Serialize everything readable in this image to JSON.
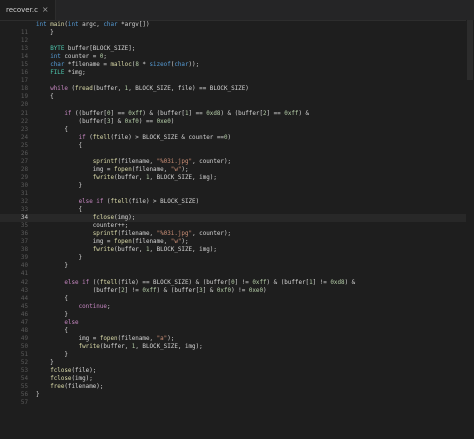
{
  "tab": {
    "filename": "recover.c",
    "close": "×"
  },
  "lines": [
    {
      "n": "",
      "text": "int main(int argc, char *argv[])"
    },
    {
      "n": "11",
      "text": "    }"
    },
    {
      "n": "12",
      "text": ""
    },
    {
      "n": "13",
      "text": "    BYTE buffer[BLOCK_SIZE];"
    },
    {
      "n": "14",
      "text": "    int counter = 0;"
    },
    {
      "n": "15",
      "text": "    char *filename = malloc(8 * sizeof(char));"
    },
    {
      "n": "16",
      "text": "    FILE *img;"
    },
    {
      "n": "17",
      "text": ""
    },
    {
      "n": "18",
      "text": "    while (fread(buffer, 1, BLOCK_SIZE, file) == BLOCK_SIZE)"
    },
    {
      "n": "19",
      "text": "    {"
    },
    {
      "n": "20",
      "text": ""
    },
    {
      "n": "21",
      "text": "        if ((buffer[0] == 0xff) & (buffer[1] == 0xd8) & (buffer[2] == 0xff) &"
    },
    {
      "n": "22",
      "text": "            (buffer[3] & 0xf0) == 0xe0)"
    },
    {
      "n": "23",
      "text": "        {"
    },
    {
      "n": "24",
      "text": "            if (ftell(file) > BLOCK_SIZE & counter ==0)"
    },
    {
      "n": "25",
      "text": "            {"
    },
    {
      "n": "26",
      "text": ""
    },
    {
      "n": "27",
      "text": "                sprintf(filename, \"%03i.jpg\", counter);"
    },
    {
      "n": "28",
      "text": "                img = fopen(filename, \"w\");"
    },
    {
      "n": "29",
      "text": "                fwrite(buffer, 1, BLOCK_SIZE, img);"
    },
    {
      "n": "30",
      "text": "            }"
    },
    {
      "n": "31",
      "text": ""
    },
    {
      "n": "32",
      "text": "            else if (ftell(file) > BLOCK_SIZE)"
    },
    {
      "n": "33",
      "text": "            {"
    },
    {
      "n": "34",
      "text": "                fclose(img);"
    },
    {
      "n": "35",
      "text": "                counter++;"
    },
    {
      "n": "36",
      "text": "                sprintf(filename, \"%03i.jpg\", counter);"
    },
    {
      "n": "37",
      "text": "                img = fopen(filename, \"w\");"
    },
    {
      "n": "38",
      "text": "                fwrite(buffer, 1, BLOCK_SIZE, img);"
    },
    {
      "n": "39",
      "text": "            }"
    },
    {
      "n": "40",
      "text": "        }"
    },
    {
      "n": "41",
      "text": ""
    },
    {
      "n": "42",
      "text": "        else if ((ftell(file) == BLOCK_SIZE) & (buffer[0] != 0xff) & (buffer[1] != 0xd8) &"
    },
    {
      "n": "43",
      "text": "                (buffer[2] != 0xff) & (buffer[3] & 0xf0) != 0xe0)"
    },
    {
      "n": "44",
      "text": "        {"
    },
    {
      "n": "45",
      "text": "            continue;"
    },
    {
      "n": "46",
      "text": "        }"
    },
    {
      "n": "47",
      "text": "        else"
    },
    {
      "n": "48",
      "text": "        {"
    },
    {
      "n": "49",
      "text": "            img = fopen(filename, \"a\");"
    },
    {
      "n": "50",
      "text": "            fwrite(buffer, 1, BLOCK_SIZE, img);"
    },
    {
      "n": "51",
      "text": "        }"
    },
    {
      "n": "52",
      "text": "    }"
    },
    {
      "n": "53",
      "text": "    fclose(file);"
    },
    {
      "n": "54",
      "text": "    fclose(img);"
    },
    {
      "n": "55",
      "text": "    free(filename);"
    },
    {
      "n": "56",
      "text": "}"
    },
    {
      "n": "57",
      "text": ""
    }
  ]
}
